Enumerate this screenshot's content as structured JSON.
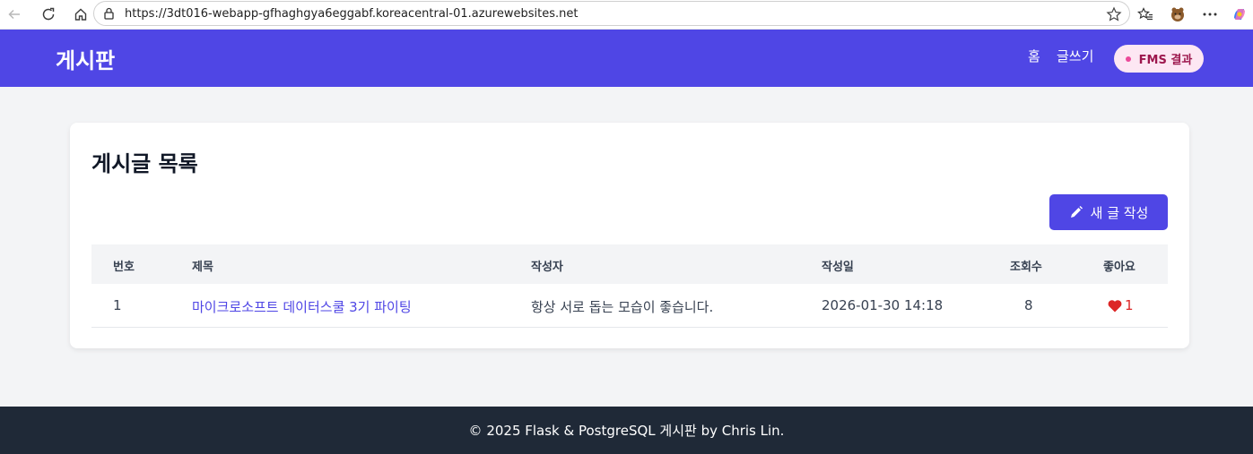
{
  "browser": {
    "url": "https://3dt016-webapp-gfhaghgya6eggabf.koreacentral-01.azurewebsites.net",
    "icons": [
      "back-icon",
      "reload-icon",
      "home-icon",
      "lock-icon",
      "star-icon",
      "favorites-icon",
      "profile-avatar-icon",
      "more-icon",
      "copilot-icon"
    ]
  },
  "header": {
    "brand": "게시판",
    "nav": {
      "home": "홈",
      "write": "글쓰기"
    },
    "fms_label": "FMS 결과"
  },
  "card": {
    "title": "게시글 목록",
    "new_post_label": "새 글 작성"
  },
  "table": {
    "headers": {
      "no": "번호",
      "title": "제목",
      "author": "작성자",
      "date": "작성일",
      "views": "조회수",
      "likes": "좋아요"
    },
    "rows": [
      {
        "no": "1",
        "title": "마이크로소프트 데이터스쿨 3기 파이팅",
        "author": "항상 서로 돕는 모습이 좋습니다.",
        "date": "2026-01-30 14:18",
        "views": "8",
        "likes": "1"
      }
    ]
  },
  "footer": {
    "text": "© 2025 Flask & PostgreSQL 게시판 by Chris Lin."
  },
  "colors": {
    "primary": "#4f46e5",
    "footer_bg": "#1f2937",
    "heart": "#dc2626",
    "fms_bg": "#fde7f3",
    "fms_text": "#9d174d"
  }
}
